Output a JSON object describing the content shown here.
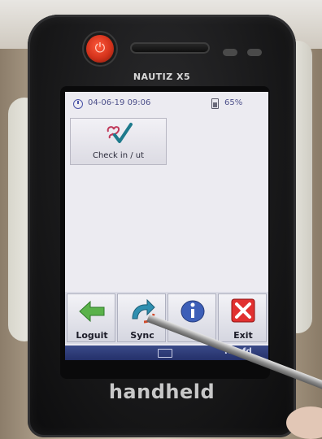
{
  "device": {
    "model_label": "NAUTIZ X5",
    "brand_label": "handheld"
  },
  "statusbar": {
    "datetime": "04-06-19 09:06",
    "battery": "65%"
  },
  "tiles": [
    {
      "label": "Check in / ut"
    }
  ],
  "toolbar": {
    "buttons": [
      {
        "label": "Loguit",
        "icon": "back-arrow-icon"
      },
      {
        "label": "Sync",
        "icon": "sync-icon"
      },
      {
        "label": "",
        "icon": "info-icon"
      },
      {
        "label": "Exit",
        "icon": "exit-icon"
      }
    ]
  },
  "bottombar": {
    "label": "Hoofd",
    "keyboard_icon": "keyboard-icon"
  },
  "colors": {
    "screen_bg": "#ecebf1",
    "bottombar": "#2c3878",
    "exit_red": "#e13030",
    "checkmark_teal": "#1e7a8c"
  }
}
